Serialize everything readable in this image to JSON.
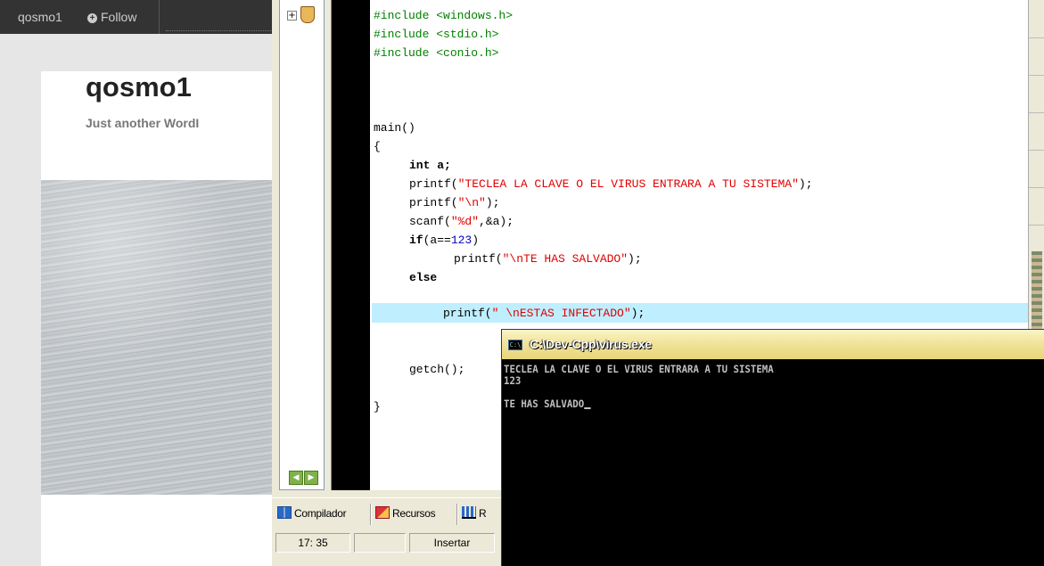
{
  "wordpress": {
    "site_name": "qosmo1",
    "follow_label": "Follow",
    "blog_title": "qosmo1",
    "tagline": "Just another WordI"
  },
  "ide": {
    "code_lines": [
      "#include <windows.h>",
      "#include <stdio.h>",
      "#include <conio.h>",
      "main()",
      "{",
      "int a;",
      "printf(\"TECLEA LA CLAVE O EL VIRUS ENTRARA A TU SISTEMA\");",
      "printf(\"\\n\");",
      "scanf(\"%d\",&a);",
      "if(a==123)",
      "printf(\"\\nTE HAS SALVADO\");",
      "else",
      "printf(\" \\nESTAS INFECTADO\");",
      "getch();",
      "}"
    ],
    "tabs": {
      "compiler": "Compilador",
      "resources": "Recursos",
      "partial": "R"
    },
    "status": {
      "position": "17: 35",
      "mode": "Insertar"
    },
    "colors": {
      "preprocessor": "#008000",
      "string": "#e00000",
      "number": "#0000c0",
      "current_line": "#bfefff"
    }
  },
  "console": {
    "title": "C:\\Dev-Cpp\\virus.exe",
    "icon": "console-icon",
    "output": [
      "TECLEA LA CLAVE O EL VIRUS ENTRARA A TU SISTEMA",
      "123",
      "",
      "TE HAS SALVADO"
    ]
  }
}
